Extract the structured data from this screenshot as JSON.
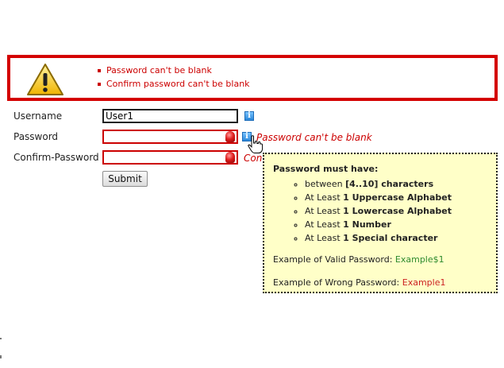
{
  "summary_errors": [
    "Password can't be blank",
    "Confirm password can't be blank"
  ],
  "form": {
    "username_label": "Username",
    "username_value": "User1",
    "password_label": "Password",
    "password_value": "",
    "confirm_label": "Confirm-Password",
    "confirm_value": "",
    "password_error": "Password can't be blank",
    "confirm_error_visible": "Con",
    "submit_label": "Submit"
  },
  "tooltip": {
    "title": "Password must have:",
    "rules": [
      {
        "pre": "between ",
        "bold": "[4..10] characters"
      },
      {
        "pre": "At Least ",
        "bold": "1 Uppercase Alphabet"
      },
      {
        "pre": "At Least ",
        "bold": "1 Lowercase Alphabet"
      },
      {
        "pre": "At Least ",
        "bold": "1 Number"
      },
      {
        "pre": "At Least ",
        "bold": "1 Special character"
      }
    ],
    "valid_label": "Example of Valid Password: ",
    "valid_value": "Example$1",
    "wrong_label": "Example of Wrong Password: ",
    "wrong_value": "Example1"
  },
  "icons": {
    "warning": "warning-icon",
    "error": "error-icon",
    "info": "info-icon",
    "cursor": "hand-cursor-icon"
  },
  "colors": {
    "error_red": "#cc0000",
    "tooltip_bg": "#ffffc8",
    "valid_green": "#2e8b2e",
    "wrong_red": "#cc2222"
  }
}
